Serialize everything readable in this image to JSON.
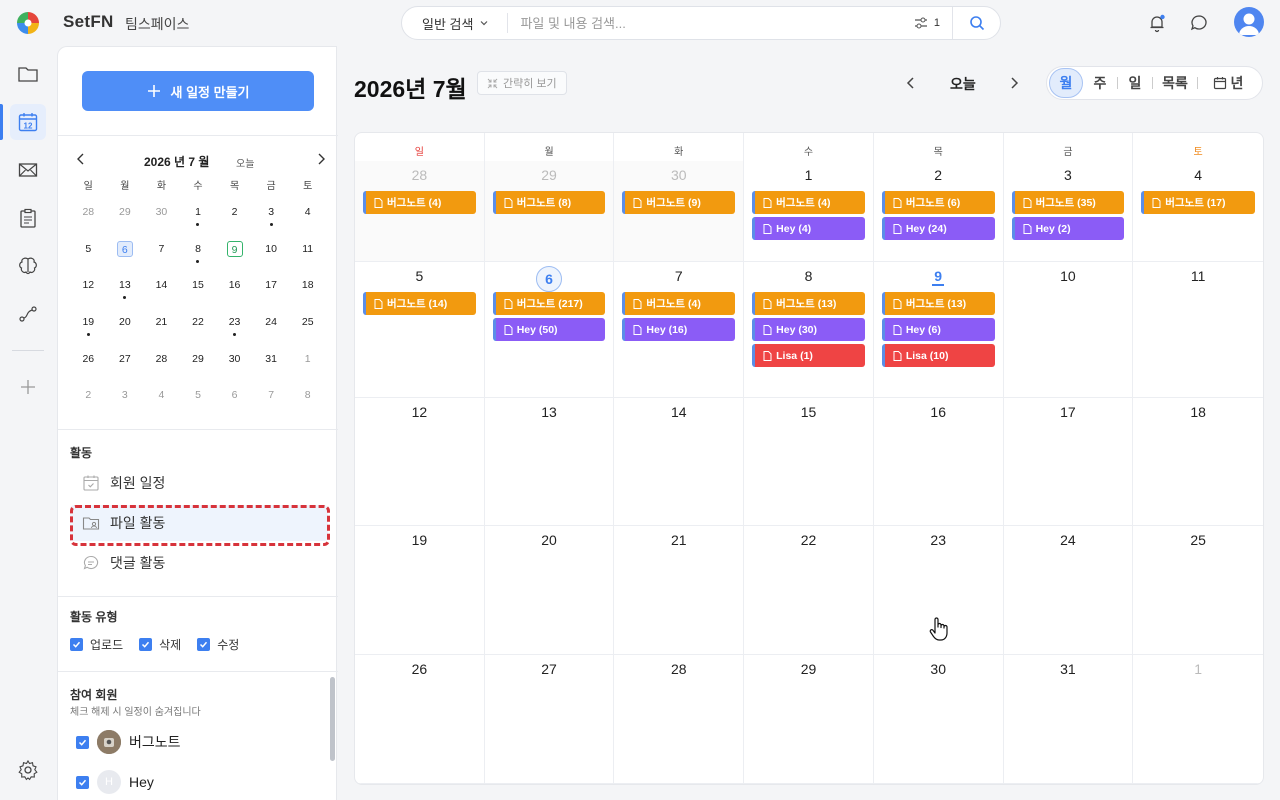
{
  "header": {
    "brand": "SetFN",
    "workspace": "팀스페이스",
    "search_type": "일반 검색",
    "search_placeholder": "파일 및 내용 검색...",
    "filter_count": "1"
  },
  "sidebar": {
    "new_button": "새 일정 만들기",
    "mini_calendar": {
      "title": "2026 년 7 월",
      "today_label": "오늘",
      "dow": [
        "일",
        "월",
        "화",
        "수",
        "목",
        "금",
        "토"
      ],
      "weeks": [
        [
          {
            "d": "28",
            "m": true
          },
          {
            "d": "29",
            "m": true
          },
          {
            "d": "30",
            "m": true
          },
          {
            "d": "1",
            "dot": true
          },
          {
            "d": "2"
          },
          {
            "d": "3",
            "dot": true
          },
          {
            "d": "4"
          }
        ],
        [
          {
            "d": "5"
          },
          {
            "d": "6",
            "today": true
          },
          {
            "d": "7"
          },
          {
            "d": "8",
            "dot": true
          },
          {
            "d": "9",
            "sel": true
          },
          {
            "d": "10"
          },
          {
            "d": "11"
          }
        ],
        [
          {
            "d": "12"
          },
          {
            "d": "13",
            "dot": true
          },
          {
            "d": "14"
          },
          {
            "d": "15"
          },
          {
            "d": "16"
          },
          {
            "d": "17"
          },
          {
            "d": "18"
          }
        ],
        [
          {
            "d": "19",
            "dot": true
          },
          {
            "d": "20"
          },
          {
            "d": "21"
          },
          {
            "d": "22"
          },
          {
            "d": "23",
            "dot": true
          },
          {
            "d": "24"
          },
          {
            "d": "25"
          }
        ],
        [
          {
            "d": "26"
          },
          {
            "d": "27"
          },
          {
            "d": "28"
          },
          {
            "d": "29"
          },
          {
            "d": "30"
          },
          {
            "d": "31"
          },
          {
            "d": "1",
            "m": true
          }
        ],
        [
          {
            "d": "2",
            "m": true
          },
          {
            "d": "3",
            "m": true
          },
          {
            "d": "4",
            "m": true
          },
          {
            "d": "5",
            "m": true
          },
          {
            "d": "6",
            "m": true
          },
          {
            "d": "7",
            "m": true
          },
          {
            "d": "8",
            "m": true
          }
        ]
      ]
    },
    "activity_title": "활동",
    "activity_items": [
      "회원 일정",
      "파일 활동",
      "댓글 활동"
    ],
    "activity_type_title": "활동 유형",
    "activity_types": [
      "업로드",
      "삭제",
      "수정"
    ],
    "members_title": "참여 회원",
    "members_hint": "체크 해제 시 일정이 숨겨집니다",
    "members": [
      {
        "name": "버그노트",
        "initial": ""
      },
      {
        "name": "Hey",
        "initial": "H"
      }
    ]
  },
  "main": {
    "title": "2026년 7월",
    "simple_view": "간략히 보기",
    "today_button": "오늘",
    "views": [
      "월",
      "주",
      "일",
      "목록",
      "년"
    ],
    "dow": [
      "일",
      "월",
      "화",
      "수",
      "목",
      "금",
      "토"
    ],
    "days": [
      {
        "d": "28",
        "m": true,
        "ev": [
          [
            "buggy",
            "버그노트 (4)"
          ]
        ]
      },
      {
        "d": "29",
        "m": true,
        "ev": [
          [
            "buggy",
            "버그노트 (8)"
          ]
        ]
      },
      {
        "d": "30",
        "m": true,
        "ev": [
          [
            "buggy",
            "버그노트 (9)"
          ]
        ]
      },
      {
        "d": "1",
        "ev": [
          [
            "buggy",
            "버그노트 (4)"
          ],
          [
            "hey",
            "Hey (4)"
          ]
        ]
      },
      {
        "d": "2",
        "ev": [
          [
            "buggy",
            "버그노트 (6)"
          ],
          [
            "hey",
            "Hey (24)"
          ]
        ]
      },
      {
        "d": "3",
        "ev": [
          [
            "buggy",
            "버그노트 (35)"
          ],
          [
            "hey",
            "Hey (2)"
          ]
        ]
      },
      {
        "d": "4",
        "ev": [
          [
            "buggy",
            "버그노트 (17)"
          ]
        ]
      },
      {
        "d": "5",
        "ev": [
          [
            "buggy",
            "버그노트 (14)"
          ]
        ]
      },
      {
        "d": "6",
        "today": true,
        "ev": [
          [
            "buggy",
            "버그노트 (217)"
          ],
          [
            "hey",
            "Hey (50)"
          ]
        ]
      },
      {
        "d": "7",
        "ev": [
          [
            "buggy",
            "버그노트 (4)"
          ],
          [
            "hey",
            "Hey (16)"
          ]
        ]
      },
      {
        "d": "8",
        "ev": [
          [
            "buggy",
            "버그노트 (13)"
          ],
          [
            "hey",
            "Hey (30)"
          ],
          [
            "lisa",
            "Lisa (1)"
          ]
        ]
      },
      {
        "d": "9",
        "sel": true,
        "ev": [
          [
            "buggy",
            "버그노트 (13)"
          ],
          [
            "hey",
            "Hey (6)"
          ],
          [
            "lisa",
            "Lisa (10)"
          ]
        ]
      },
      {
        "d": "10",
        "ev": []
      },
      {
        "d": "11",
        "ev": []
      },
      {
        "d": "12",
        "ev": []
      },
      {
        "d": "13",
        "ev": []
      },
      {
        "d": "14",
        "ev": []
      },
      {
        "d": "15",
        "ev": []
      },
      {
        "d": "16",
        "ev": []
      },
      {
        "d": "17",
        "ev": []
      },
      {
        "d": "18",
        "ev": []
      },
      {
        "d": "19",
        "ev": []
      },
      {
        "d": "20",
        "ev": []
      },
      {
        "d": "21",
        "ev": []
      },
      {
        "d": "22",
        "ev": []
      },
      {
        "d": "23",
        "ev": []
      },
      {
        "d": "24",
        "ev": []
      },
      {
        "d": "25",
        "ev": []
      },
      {
        "d": "26",
        "ev": []
      },
      {
        "d": "27",
        "ev": []
      },
      {
        "d": "28",
        "ev": []
      },
      {
        "d": "29",
        "ev": []
      },
      {
        "d": "30",
        "ev": []
      },
      {
        "d": "31",
        "ev": []
      },
      {
        "d": "1",
        "m": true,
        "ev": []
      }
    ]
  },
  "colors": {
    "accent": "#3d7ff0",
    "buggy": "#f29a0f",
    "hey": "#8b5cf6",
    "lisa": "#ef4444",
    "highlight_border": "#d7333b"
  }
}
